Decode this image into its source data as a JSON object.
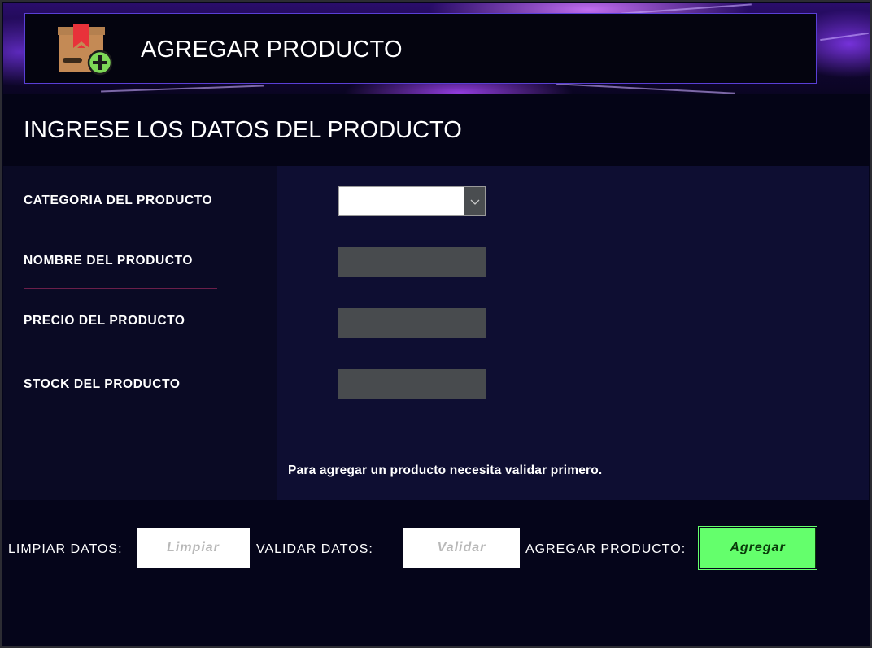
{
  "header": {
    "title": "AGREGAR PRODUCTO",
    "icon": "box-add-icon"
  },
  "section": {
    "title": "INGRESE LOS DATOS DEL PRODUCTO"
  },
  "form": {
    "category_label": "CATEGORIA DEL PRODUCTO",
    "category_value": "",
    "name_label": "NOMBRE DEL PRODUCTO",
    "name_value": "",
    "price_label": "PRECIO DEL PRODUCTO",
    "price_value": "",
    "stock_label": "STOCK DEL PRODUCTO",
    "stock_value": "",
    "hint": "Para agregar un producto necesita validar primero."
  },
  "actions": {
    "clear_label": "LIMPIAR DATOS:",
    "clear_button": "Limpiar",
    "validate_label": "VALIDAR DATOS:",
    "validate_button": "Validar",
    "add_label": "AGREGAR PRODUCTO:",
    "add_button": "Agregar"
  },
  "colors": {
    "background": "#05051a",
    "accent_border": "#5a3fd6",
    "input_background": "#484b4e",
    "add_button": "#64ff6c"
  }
}
